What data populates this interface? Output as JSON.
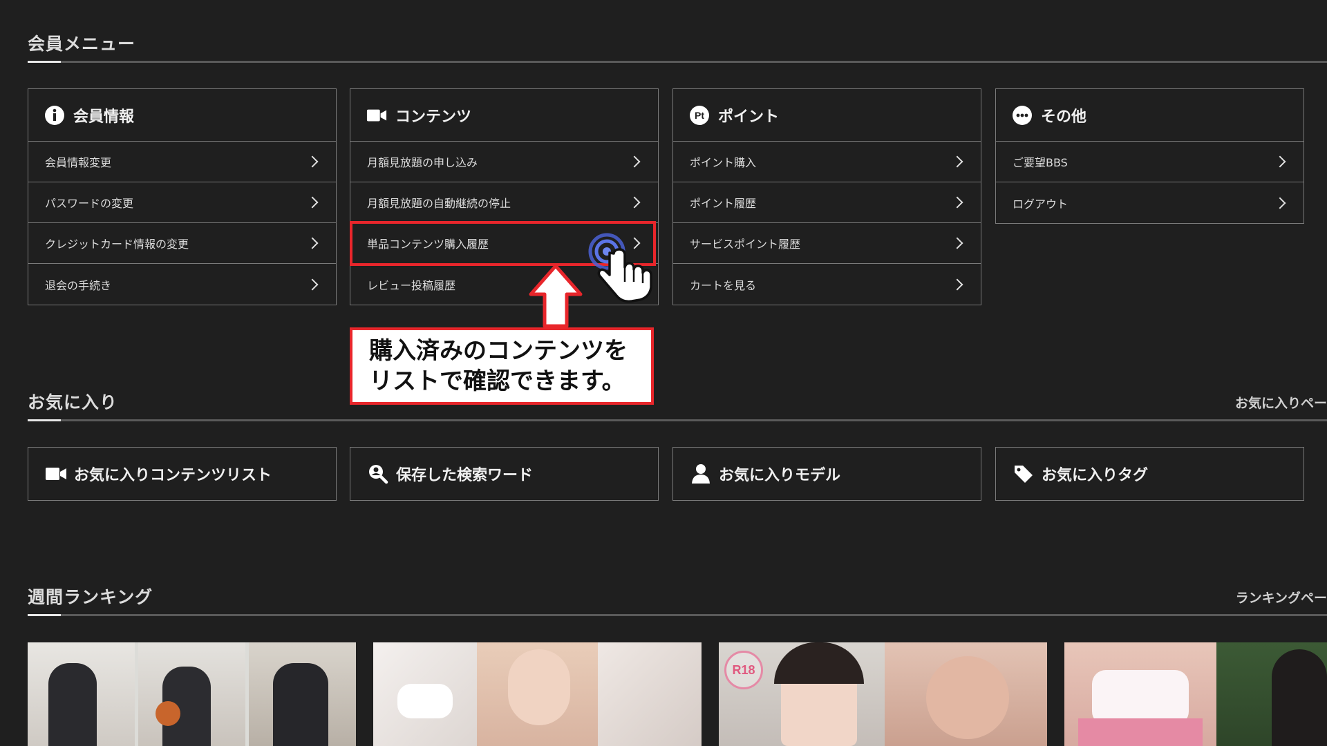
{
  "member_menu": {
    "title": "会員メニュー"
  },
  "cards": [
    {
      "title": "会員情報",
      "icon": "info-icon",
      "items": [
        "会員情報変更",
        "パスワードの変更",
        "クレジットカード情報の変更",
        "退会の手続き"
      ]
    },
    {
      "title": "コンテンツ",
      "icon": "video-camera-icon",
      "items": [
        "月額見放題の申し込み",
        "月額見放題の自動継続の停止",
        "単品コンテンツ購入履歴",
        "レビュー投稿履歴"
      ]
    },
    {
      "title": "ポイント",
      "icon": "points-pt-icon",
      "items": [
        "ポイント購入",
        "ポイント履歴",
        "サービスポイント履歴",
        "カートを見る"
      ]
    },
    {
      "title": "その他",
      "icon": "more-dots-icon",
      "items": [
        "ご要望BBS",
        "ログアウト"
      ]
    }
  ],
  "annotation": {
    "line1": "購入済みのコンテンツを",
    "line2": "リストで確認できます。",
    "highlight_color": "#e8262b"
  },
  "favorites": {
    "title": "お気に入り",
    "link": "お気に入りペー",
    "items": [
      {
        "label": "お気に入りコンテンツリスト",
        "icon": "video-camera-icon"
      },
      {
        "label": "保存した検索ワード",
        "icon": "search-person-icon"
      },
      {
        "label": "お気に入りモデル",
        "icon": "person-icon"
      },
      {
        "label": "お気に入りタグ",
        "icon": "tag-icon"
      }
    ]
  },
  "ranking": {
    "title": "週間ランキング",
    "link": "ランキングペー",
    "badge": "R18"
  }
}
